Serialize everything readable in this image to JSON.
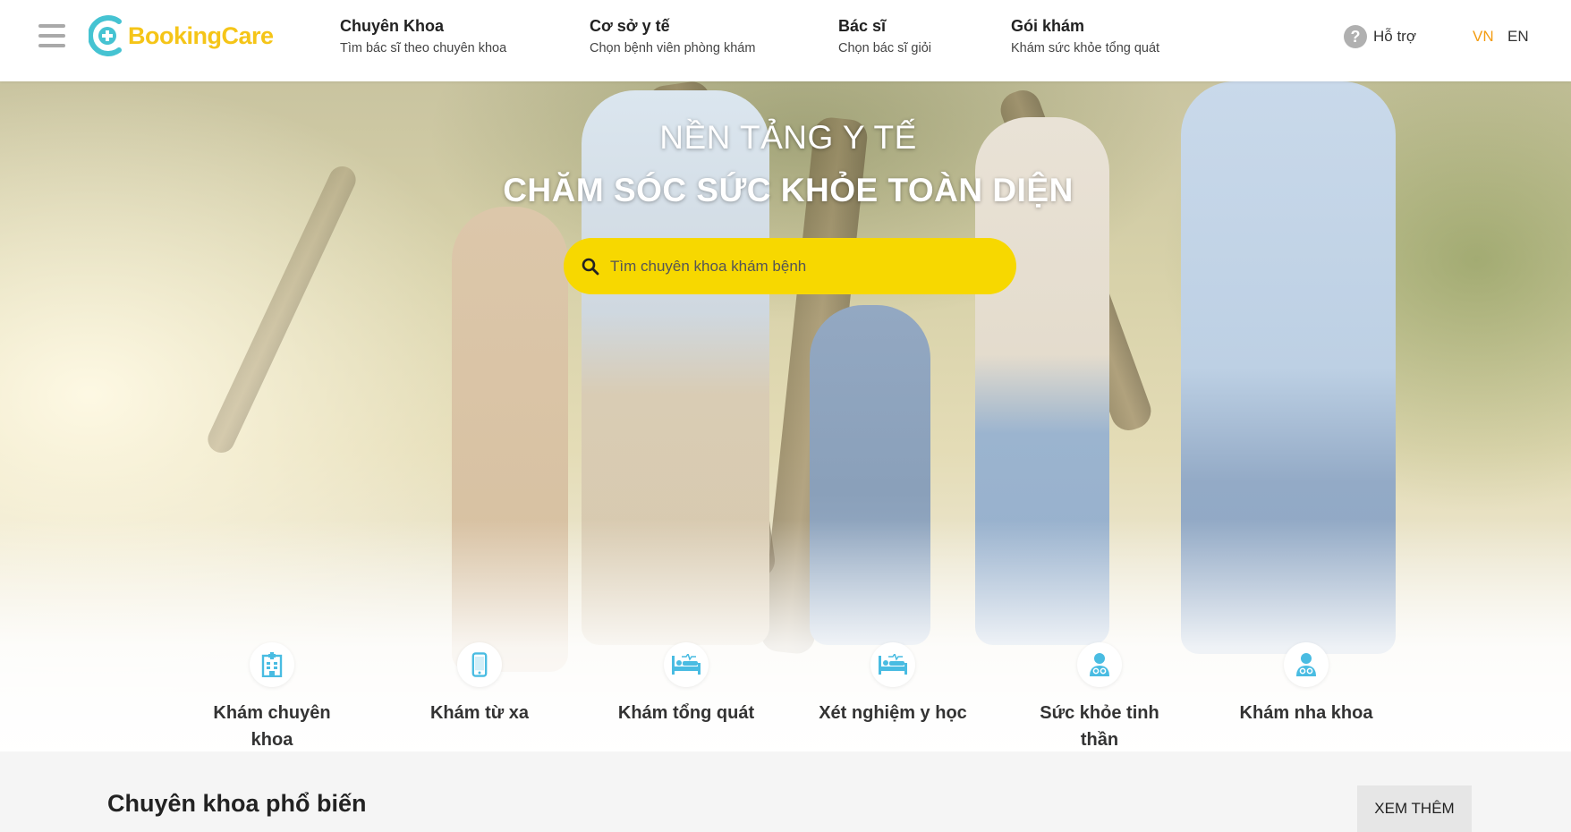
{
  "header": {
    "logo_text": "BookingCare",
    "nav": [
      {
        "title": "Chuyên Khoa",
        "subtitle": "Tìm bác sĩ theo chuyên khoa"
      },
      {
        "title": "Cơ sở y tế",
        "subtitle": "Chọn bệnh viên phòng khám"
      },
      {
        "title": "Bác sĩ",
        "subtitle": "Chọn bác sĩ giỏi"
      },
      {
        "title": "Gói khám",
        "subtitle": "Khám sức khỏe tổng quát"
      }
    ],
    "support_label": "Hỗ trợ",
    "lang_vn": "VN",
    "lang_en": "EN"
  },
  "hero": {
    "title_line1": "NỀN TẢNG Y TẾ",
    "title_line2": "CHĂM SÓC SỨC KHỎE TOÀN DIỆN",
    "search_placeholder": "Tìm chuyên khoa khám bệnh"
  },
  "categories": [
    {
      "label": "Khám chuyên khoa",
      "icon": "hospital-icon"
    },
    {
      "label": "Khám từ xa",
      "icon": "mobile-phone-icon"
    },
    {
      "label": "Khám tổng quát",
      "icon": "hospital-bed-icon"
    },
    {
      "label": "Xét nghiệm y học",
      "icon": "hospital-bed-icon"
    },
    {
      "label": "Sức khỏe tinh thần",
      "icon": "doctor-icon"
    },
    {
      "label": "Khám nha khoa",
      "icon": "doctor-icon"
    }
  ],
  "section": {
    "title": "Chuyên khoa phổ biến",
    "more_button": "XEM THÊM"
  },
  "colors": {
    "brand_yellow": "#f7d800",
    "brand_blue": "#45c3d2",
    "lang_active": "#f39c12",
    "icon_blue": "#49bce2"
  }
}
